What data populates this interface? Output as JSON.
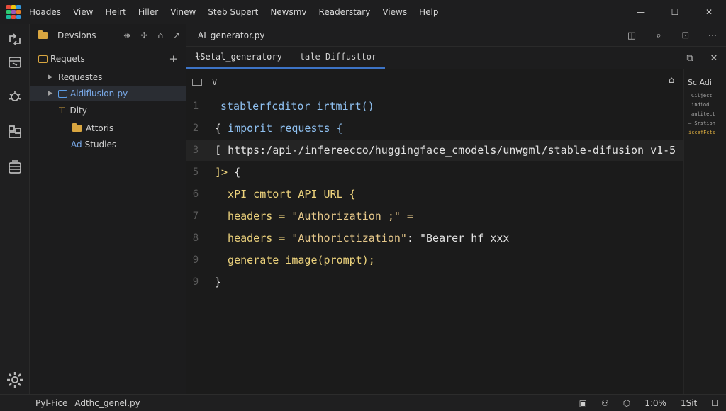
{
  "menu": [
    "Hoades",
    "View",
    "Heirt",
    "Filler",
    "Vinew",
    "Steb Supert",
    "Newsmv",
    "Readerstary",
    "Views",
    "Help"
  ],
  "window_controls": {
    "minimize": "—",
    "maximize": "☐",
    "close": "✕"
  },
  "sidebar": {
    "title": "Devsions",
    "items": [
      {
        "label": "Requets"
      },
      {
        "label": "Requestes"
      },
      {
        "label": "Aldiflusion-py"
      },
      {
        "label": "Dity"
      },
      {
        "label": "Attoris"
      },
      {
        "label": "Studies"
      }
    ],
    "item_prefix_ad": "Ad"
  },
  "editor": {
    "file_tab": "AI_generator.py",
    "tabs": [
      "ɫSetal_generatory",
      "tale Diffusttor"
    ],
    "breadcrumb_icon": "V",
    "lines": [
      {
        "n": "1",
        "parts": [
          {
            "t": "stablerfcditor irtmirt()",
            "c": "c-b"
          }
        ]
      },
      {
        "n": "2",
        "parts": [
          {
            "t": "{ ",
            "c": "c-w"
          },
          {
            "t": "imporit requests {",
            "c": "c-b"
          }
        ]
      },
      {
        "n": "3",
        "parts": [
          {
            "t": "[ ",
            "c": "c-w"
          },
          {
            "t": "https:/api-/infereecco/huggingface_cmodels/unwgml/stable-difusion v1-5",
            "c": "c-w"
          }
        ]
      },
      {
        "n": "5",
        "parts": [
          {
            "t": "]> ",
            "c": "c-y"
          },
          {
            "t": "{",
            "c": "c-w"
          }
        ]
      },
      {
        "n": "6",
        "parts": [
          {
            "t": "  xPI cmtort ",
            "c": "c-y"
          },
          {
            "t": "API URL {",
            "c": "c-y"
          }
        ]
      },
      {
        "n": "7",
        "parts": [
          {
            "t": "  headers = ",
            "c": "c-y"
          },
          {
            "t": "\"Authorization ;\" =",
            "c": "c-s"
          }
        ]
      },
      {
        "n": "8",
        "parts": [
          {
            "t": "  headers = ",
            "c": "c-y"
          },
          {
            "t": "\"Authorictization\"",
            "c": "c-s"
          },
          {
            "t": ": \"Bearer hf_xxx",
            "c": "c-w"
          }
        ]
      },
      {
        "n": "9",
        "parts": [
          {
            "t": "  generate_image(prompt);",
            "c": "c-y"
          }
        ]
      },
      {
        "n": "9",
        "parts": [
          {
            "t": "}",
            "c": "c-w"
          }
        ]
      }
    ]
  },
  "minimap": {
    "title": "Sc Adi",
    "lines": [
      "Cilject",
      "indiod",
      "anlitect",
      "— Srstion",
      "iccefFcts"
    ]
  },
  "status": {
    "left": [
      "Pyl-Fice",
      "Adthc_genel.py"
    ],
    "right": [
      "1:0%",
      "1Sit"
    ]
  },
  "colors": {
    "accent": "#3d74c7",
    "folder": "#d9a640",
    "keyword": "#ecd27c",
    "blue": "#8fc0f0"
  }
}
